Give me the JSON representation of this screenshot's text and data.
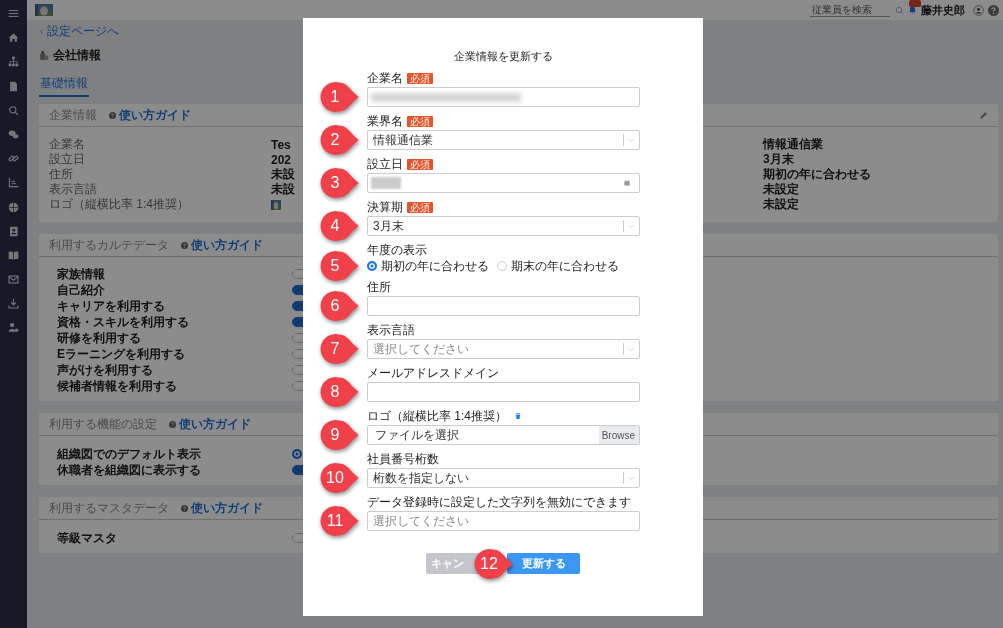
{
  "topbar": {
    "search": {
      "placeholder": "従業員を検索"
    },
    "user_name": "藤井史郎"
  },
  "back_link": "設定ページへ",
  "page_title": "会社情報",
  "tabs": [
    {
      "label": "基礎情報",
      "selected": true
    }
  ],
  "company_card": {
    "title": "企業情報",
    "guide": "使い方ガイド",
    "rows": [
      {
        "label": "企業名",
        "value": "Tes"
      },
      {
        "label": "設立日",
        "value": "202"
      },
      {
        "label": "住所",
        "value": "未設"
      },
      {
        "label": "表示言語",
        "value": "未設"
      },
      {
        "label": "ロゴ（縦横比率 1:4推奨）",
        "kind": "logo"
      }
    ],
    "column_3": [
      "情報通信業",
      "3月末",
      "期初の年に合わせる",
      "未設定",
      "未設定"
    ]
  },
  "settings_cards": [
    {
      "title": "利用するカルテデータ",
      "guide": "使い方ガイド",
      "rows": [
        {
          "label": "家族情報",
          "kind": "toggle",
          "on": false
        },
        {
          "label": "自己紹介",
          "kind": "toggle",
          "on": true
        },
        {
          "label": "キャリアを利用する",
          "kind": "toggle",
          "on": true
        },
        {
          "label": "資格・スキルを利用する",
          "kind": "toggle",
          "on": true
        },
        {
          "label": "研修を利用する",
          "kind": "toggle",
          "on": false
        },
        {
          "label": "Eラーニングを利用する",
          "kind": "toggle",
          "on": false
        },
        {
          "label": "声がけを利用する",
          "kind": "toggle",
          "on": false
        },
        {
          "label": "候補者情報を利用する",
          "kind": "toggle",
          "on": false
        }
      ]
    },
    {
      "title": "利用する機能の設定",
      "guide": "使い方ガイド",
      "rows": [
        {
          "label": "組織図でのデフォルト表示",
          "kind": "radio",
          "selected": true
        },
        {
          "label": "休職者を組織図に表示する",
          "kind": "toggle",
          "on": true
        }
      ]
    },
    {
      "title": "利用するマスタデータ",
      "guide": "使い方ガイド",
      "rows": [
        {
          "label": "等級マスタ",
          "kind": "toggle",
          "on": false
        }
      ]
    }
  ],
  "modal": {
    "title": "企業情報を更新する",
    "fields": [
      {
        "kind": "text",
        "label": "企業名",
        "badge": "必須",
        "redacted": true,
        "callout": "1"
      },
      {
        "kind": "select",
        "label": "業界名",
        "badge": "必須",
        "value": "情報通信業",
        "callout": "2"
      },
      {
        "kind": "date",
        "label": "設立日",
        "badge": "必須",
        "redacted": true,
        "callout": "3"
      },
      {
        "kind": "select",
        "label": "決算期",
        "badge": "必須",
        "value": "3月末",
        "callout": "4"
      },
      {
        "kind": "radio",
        "label": "年度の表示",
        "options": [
          {
            "label": "期初の年に合わせる",
            "selected": true
          },
          {
            "label": "期末の年に合わせる",
            "selected": false
          }
        ],
        "callout": "5"
      },
      {
        "kind": "text",
        "label": "住所",
        "callout": "6"
      },
      {
        "kind": "select",
        "label": "表示言語",
        "placeholder": "選択してください",
        "callout": "7"
      },
      {
        "kind": "text",
        "label": "メールアドレスドメイン",
        "callout": "8"
      },
      {
        "kind": "file",
        "label": "ロゴ（縦横比率 1:4推奨）",
        "file_label": "ファイルを選択",
        "browse": "Browse",
        "callout": "9"
      },
      {
        "kind": "select",
        "label": "社員番号桁数",
        "value": "桁数を指定しない",
        "callout": "10"
      },
      {
        "kind": "text",
        "label": "データ登録時に設定した文字列を無効にできます",
        "placeholder": "選択してください",
        "callout": "11"
      }
    ],
    "buttons": [
      {
        "kind": "cancel",
        "label": "キャン"
      },
      {
        "kind": "primary",
        "label": "更新する",
        "callout": "12"
      }
    ]
  }
}
